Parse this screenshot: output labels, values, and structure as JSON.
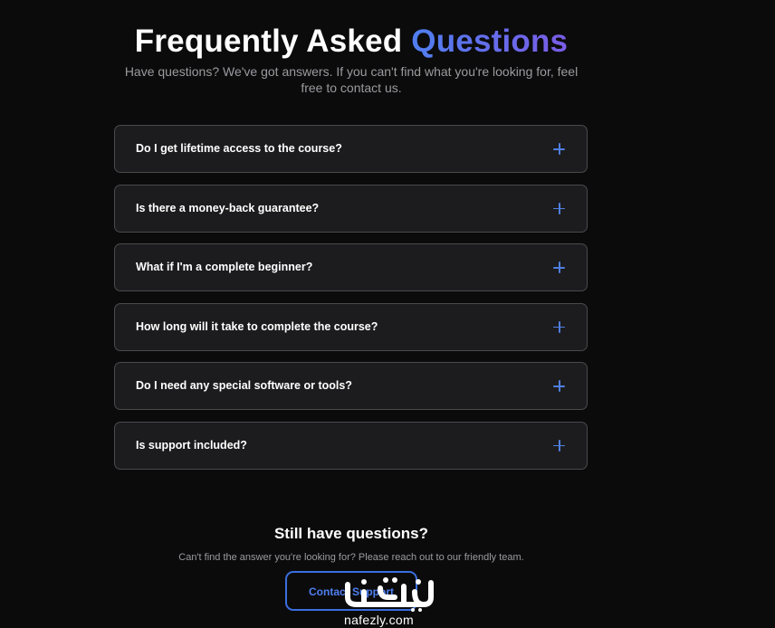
{
  "header": {
    "title_main": "Frequently Asked",
    "title_accent": "Questions",
    "subtitle": "Have questions? We've got answers. If you can't find what you're looking for, feel free to contact us."
  },
  "faq": {
    "items": [
      {
        "question": "Do I get lifetime access to the course?",
        "icon": "plus-icon"
      },
      {
        "question": "Is there a money-back guarantee?",
        "icon": "plus-icon"
      },
      {
        "question": "What if I'm a complete beginner?",
        "icon": "plus-icon"
      },
      {
        "question": "How long will it take to complete the course?",
        "icon": "plus-icon"
      },
      {
        "question": "Do I need any special software or tools?",
        "icon": "plus-icon"
      },
      {
        "question": "Is support included?",
        "icon": "plus-icon"
      }
    ]
  },
  "help": {
    "title": "Still have questions?",
    "text": "Can't find the answer you're looking for? Please reach out to our friendly team.",
    "button_label": "Contact Support"
  },
  "watermark": {
    "mark_text": "نفذلي",
    "domain": "nafezly.com"
  },
  "colors": {
    "background": "#0b0b0c",
    "card": "#1c1c1e",
    "card_border": "#4a4a4d",
    "accent_blue": "#4f7ff0",
    "accent_purple": "#7a5ce6",
    "muted_text": "#9b9b9f"
  }
}
